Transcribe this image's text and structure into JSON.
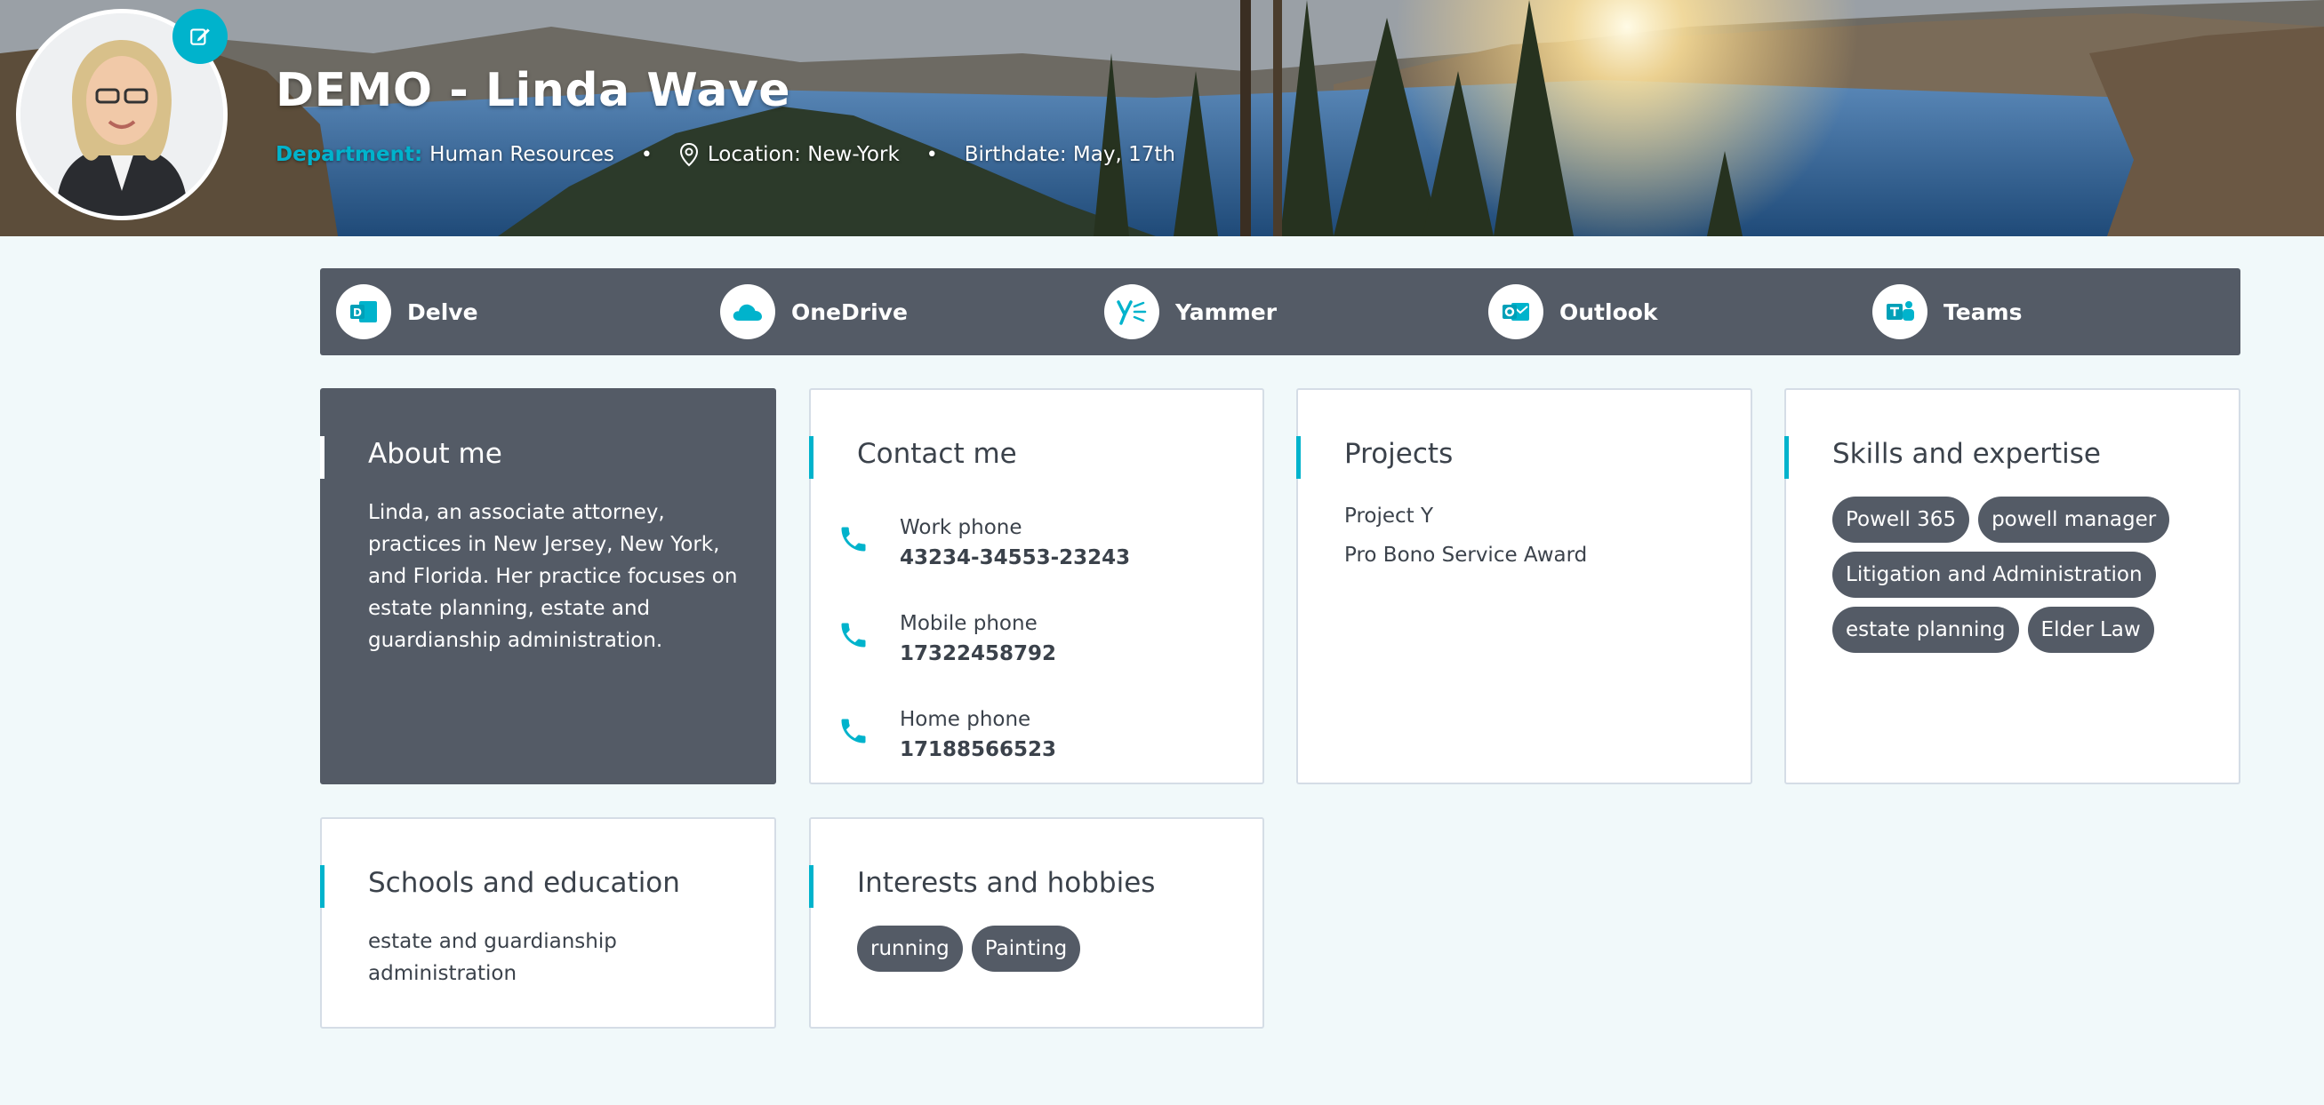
{
  "header": {
    "name": "DEMO - Linda Wave",
    "department_label": "Department:",
    "department_value": "Human Resources",
    "location": "Location: New-York",
    "birthdate": "Birthdate: May, 17th",
    "separator": "•"
  },
  "apps": [
    {
      "label": "Delve",
      "icon": "delve-icon"
    },
    {
      "label": "OneDrive",
      "icon": "onedrive-icon"
    },
    {
      "label": "Yammer",
      "icon": "yammer-icon"
    },
    {
      "label": "Outlook",
      "icon": "outlook-icon"
    },
    {
      "label": "Teams",
      "icon": "teams-icon"
    }
  ],
  "about": {
    "title": "About me",
    "lines": [
      "Linda, an associate attorney,",
      "practices in New Jersey, New York,",
      "and Florida. Her practice focuses on",
      "estate planning, estate and",
      "guardianship administration."
    ]
  },
  "contact": {
    "title": "Contact me",
    "items": [
      {
        "label": "Work phone",
        "value": "43234-34553-23243"
      },
      {
        "label": "Mobile phone",
        "value": "17322458792"
      },
      {
        "label": "Home phone",
        "value": "17188566523"
      }
    ]
  },
  "projects": {
    "title": "Projects",
    "items": [
      "Project Y",
      "Pro Bono Service Award"
    ]
  },
  "skills": {
    "title": "Skills and expertise",
    "tags": [
      "Powell 365",
      "powell manager",
      "Litigation and Administration",
      "estate planning",
      "Elder Law"
    ]
  },
  "schools": {
    "title": "Schools and education",
    "lines": [
      "estate and guardianship",
      "administration"
    ]
  },
  "interests": {
    "title": "Interests and hobbies",
    "tags": [
      "running",
      "Painting"
    ]
  },
  "colors": {
    "accent": "#00b3cc",
    "dark_panel": "#545b66",
    "background": "#f1f9fa"
  }
}
